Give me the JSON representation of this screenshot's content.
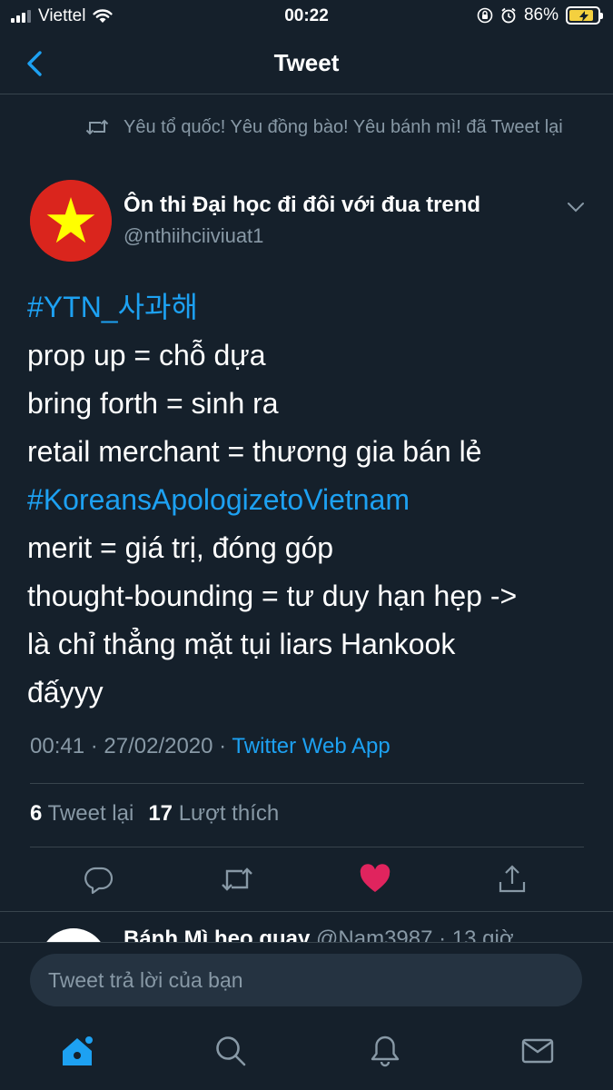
{
  "status_bar": {
    "carrier": "Viettel",
    "time": "00:22",
    "battery_percent": "86%"
  },
  "header": {
    "title": "Tweet",
    "back_icon": "chevron-left-icon"
  },
  "retweet": {
    "icon": "retweet-icon",
    "text": "Yêu tổ quốc! Yêu đồng bào! Yêu bánh mì! đã Tweet lại"
  },
  "author": {
    "name": "Ôn thi Đại học đi đôi với đua trend",
    "handle": "@nthiihciiviuat1",
    "avatar": "vietnam-flag-avatar"
  },
  "tweet": {
    "lines": [
      {
        "text": "#YTN_사과해",
        "hashtag": true
      },
      {
        "text": "prop up = chỗ dựa",
        "hashtag": false
      },
      {
        "text": "bring forth = sinh ra",
        "hashtag": false
      },
      {
        "text": "retail merchant = thương gia bán lẻ",
        "hashtag": false
      },
      {
        "text": "#KoreansApologizetoVietnam",
        "hashtag": true
      },
      {
        "text": "merit = giá trị, đóng góp",
        "hashtag": false
      },
      {
        "text": "thought-bounding = tư duy hạn hẹp ->",
        "hashtag": false
      },
      {
        "text": "là chỉ thẳng mặt tụi liars Hankook",
        "hashtag": false
      },
      {
        "text": "đấyyy",
        "hashtag": false
      }
    ],
    "timestamp": "00:41 · 27/02/2020 · ",
    "source": "Twitter Web App"
  },
  "stats": {
    "retweet_count": "6",
    "retweet_label": "Tweet lại",
    "like_count": "17",
    "like_label": "Lượt thích"
  },
  "actions": {
    "reply_icon": "reply-icon",
    "retweet_icon": "retweet-icon",
    "like_icon": "heart-filled-icon",
    "share_icon": "share-icon",
    "like_color": "#e0245e"
  },
  "reply_preview": {
    "name": "Bánh Mì heo quay",
    "rest": " @Nam3987 · 13 giờ"
  },
  "compose": {
    "placeholder": "Tweet trả lời của bạn"
  },
  "tab_bar": {
    "active_color": "#1da1f2",
    "tabs": [
      "home-icon",
      "search-icon",
      "notifications-icon",
      "messages-icon"
    ]
  }
}
